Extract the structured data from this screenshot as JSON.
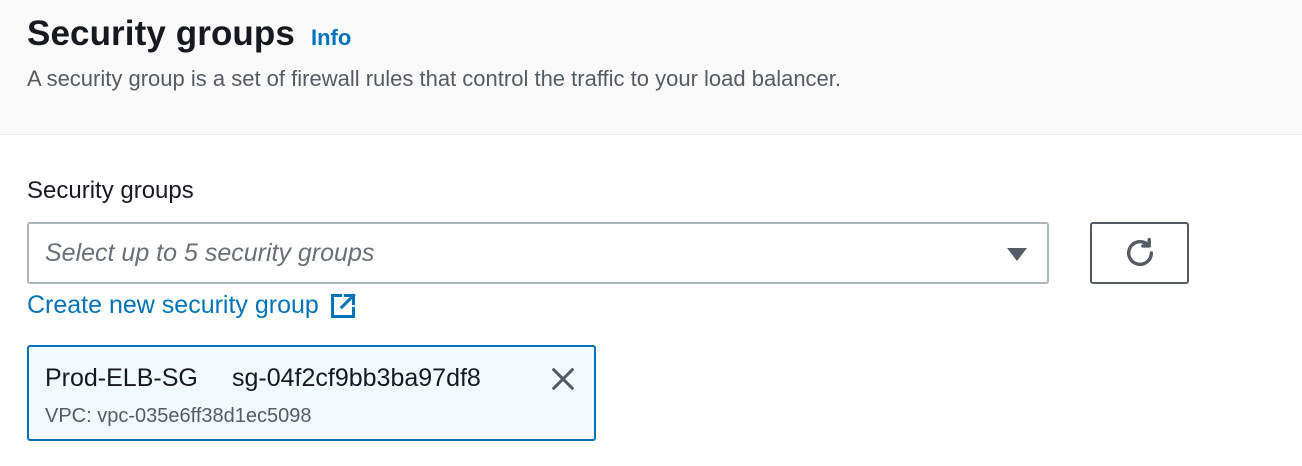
{
  "header": {
    "title": "Security groups",
    "info_link": "Info",
    "description": "A security group is a set of firewall rules that control the traffic to your load balancer."
  },
  "field": {
    "label": "Security groups",
    "placeholder": "Select up to 5 security groups"
  },
  "create_link": {
    "label": "Create new security group"
  },
  "selected_token": {
    "name": "Prod-ELB-SG",
    "id": "sg-04f2cf9bb3ba97df8",
    "vpc": "VPC: vpc-035e6ff38d1ec5098"
  },
  "icons": {
    "caret": "caret-down-icon",
    "refresh": "refresh-icon",
    "external": "external-link-icon",
    "dismiss": "close-icon"
  },
  "colors": {
    "link": "#0073bb",
    "text": "#16191f",
    "secondary_text": "#545b64",
    "placeholder": "#687078",
    "token_background": "#f1faff",
    "token_border": "#0073bb",
    "header_background": "#fafafa"
  }
}
